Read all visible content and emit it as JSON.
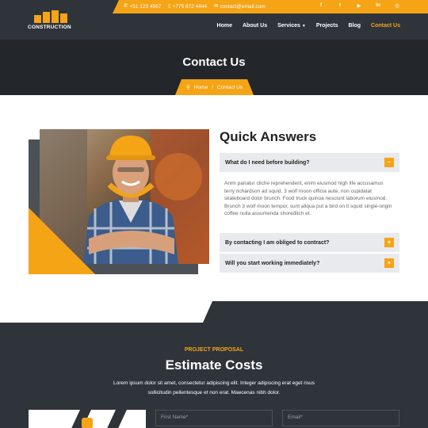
{
  "colors": {
    "accent": "#f5a416",
    "dark": "#2f343a",
    "darker": "#23272b"
  },
  "topbar": {
    "phone": "+51 123 4567",
    "mobile": "+775 872 4444",
    "email": "contact@email.com",
    "socials": [
      {
        "icon": "facebook-icon",
        "glyph": "f"
      },
      {
        "icon": "twitter-icon",
        "glyph": "t"
      },
      {
        "icon": "youtube-icon",
        "glyph": "▶"
      },
      {
        "icon": "linkedin-icon",
        "glyph": "in"
      },
      {
        "icon": "instagram-icon",
        "glyph": "◎"
      }
    ]
  },
  "brand": {
    "name": "CONSTRUCTION"
  },
  "nav": {
    "home": "Home",
    "about": "About Us",
    "services": "Services",
    "projects": "Projects",
    "blog": "Blog",
    "contact": "Contact Us"
  },
  "banner": {
    "title": "Contact Us",
    "breadcrumb_home": "Home",
    "breadcrumb_sep": "/",
    "breadcrumb_current": "Contact Us"
  },
  "faq": {
    "title": "Quick Answers",
    "items": [
      {
        "question": "What do I need before building?",
        "toggle": "–",
        "open": true,
        "answer": "Anim pariatur cliche reprehenderit, enim eiusmod high life accusamus terry richardson ad squid. 3 wolf moon officia aute, non cupidatat skateboard dolor brunch. Food truck quinoa nesciunt laborum eiusmod. Brunch 3 wolf moon tempor, sunt aliqua put a bird on it squid single-origin coffee nulla assumenda shoreditch et."
      },
      {
        "question": "By contacting I am obliged to contract?",
        "toggle": "+",
        "open": false
      },
      {
        "question": "Will you start working immediately?",
        "toggle": "+",
        "open": false
      }
    ]
  },
  "estimate": {
    "kicker": "PROJECT PROPOSAL",
    "title": "Estimate Costs",
    "description": "Lorem ipsum dolor sit amet, consectetur adipiscing elit. Integer adipiscing erat eget risus sollicitudin pellentesque et non erat. Maecenas nibh dolor.",
    "first_name_placeholder": "First Name*",
    "email_placeholder": "Email*"
  }
}
